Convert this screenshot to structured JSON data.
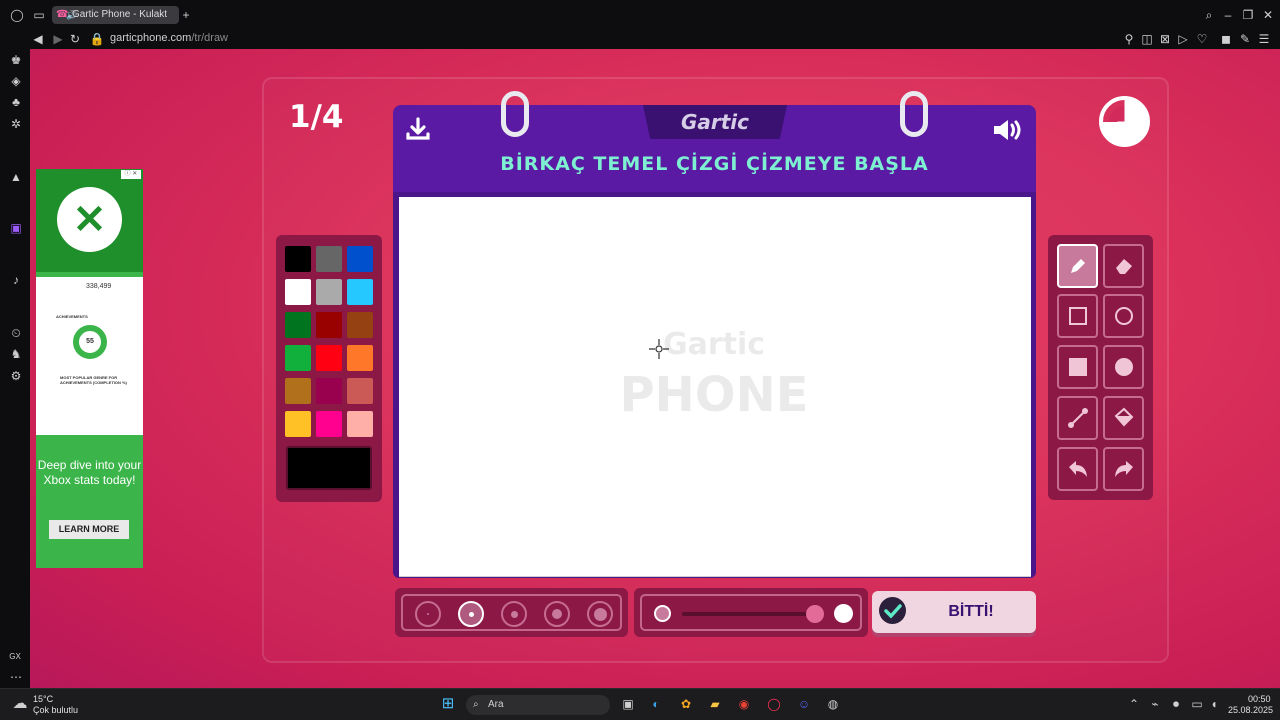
{
  "browser": {
    "tab_title": "Gartic Phone - Kulakt",
    "url_host": "garticphone.com",
    "url_path": "/tr/draw",
    "sidebar_footer": "GX"
  },
  "game": {
    "round": "1/4",
    "logo_text": "Gartic",
    "prompt": "BİRKAÇ TEMEL ÇİZGİ ÇİZMEYE BAŞLA",
    "watermark_line1": "Gartic",
    "watermark_line2": "PHONE",
    "done_label": "BİTTİ!",
    "colors": [
      "#000000",
      "#666666",
      "#0050cd",
      "#ffffff",
      "#aaaaaa",
      "#26c9ff",
      "#017420",
      "#990000",
      "#964112",
      "#11b03c",
      "#ff0013",
      "#ff7829",
      "#b0701c",
      "#99004e",
      "#cb5a57",
      "#ffc126",
      "#ff008f",
      "#feafa8"
    ],
    "selected_color": "#000000",
    "selected_tool": "pencil",
    "tools": [
      "pencil",
      "eraser",
      "rectangle-outline",
      "ellipse-outline",
      "rectangle-filled",
      "ellipse-filled",
      "line",
      "fill-bucket",
      "undo",
      "redo"
    ],
    "brush_sizes": [
      1,
      2,
      3,
      4,
      5
    ],
    "selected_size": 2
  },
  "ad": {
    "stat": "338,499",
    "achievements_label": "ACHIEVEMENTS",
    "donut_value": "55",
    "popular_label": "MOST POPULAR GENRE FOR ACHIEVEMENTS (COMPLETION %)",
    "headline": "Deep dive into your Xbox stats today!",
    "cta": "LEARN MORE"
  },
  "taskbar": {
    "temperature": "15°C",
    "weather": "Çok bulutlu",
    "search_placeholder": "Ara",
    "time": "00:50",
    "date": "25.08.2025"
  }
}
